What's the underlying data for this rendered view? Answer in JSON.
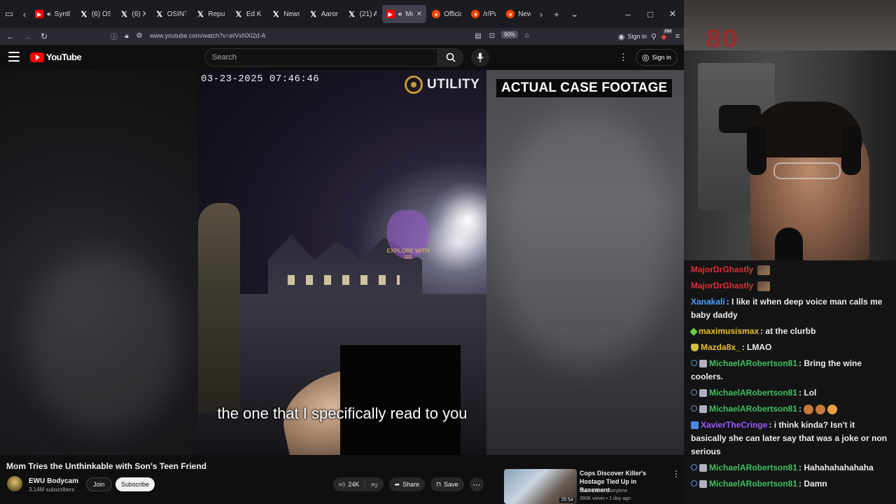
{
  "browser": {
    "tabs": [
      {
        "label": "Synth",
        "favicon": "yt",
        "audio": true
      },
      {
        "label": "(6) OS",
        "favicon": "x",
        "audio": false
      },
      {
        "label": "(6) X",
        "favicon": "x",
        "audio": false
      },
      {
        "label": "OSINT",
        "favicon": "x",
        "audio": false
      },
      {
        "label": "Repul",
        "favicon": "x",
        "audio": false
      },
      {
        "label": "Ed Kr",
        "favicon": "x",
        "audio": false
      },
      {
        "label": "News",
        "favicon": "x",
        "audio": false
      },
      {
        "label": "Aaron",
        "favicon": "x",
        "audio": false
      },
      {
        "label": "(21) A",
        "favicon": "x",
        "audio": false
      },
      {
        "label": "Mo",
        "favicon": "yt",
        "audio": true,
        "active": true
      },
      {
        "label": "Officia",
        "favicon": "rd",
        "audio": false
      },
      {
        "label": "/r/Pu",
        "favicon": "rd",
        "audio": false
      },
      {
        "label": "New",
        "favicon": "rd",
        "audio": false
      }
    ],
    "url": "www.youtube.com/watch?v=eIVsNXi2d-A",
    "zoom": "90%",
    "signin_label": "Sign in",
    "ext_badge": "264"
  },
  "youtube": {
    "logo_text": "YouTube",
    "search_placeholder": "Search",
    "signin_label": "Sign in"
  },
  "video": {
    "timestamp_overlay": "03-23-2025 07:46:46",
    "utility_label": "UTILITY",
    "banner": "ACTUAL CASE FOOTAGE",
    "watermark": "EXPLORE WITH US",
    "caption": "the one that I specifically read to you",
    "title": "Mom Tries the Unthinkable with Son's Teen Friend",
    "channel": "EWU Bodycam",
    "subscribers": "3.14M subscribers",
    "join_label": "Join",
    "subscribe_label": "Subscribe",
    "likes": "24K",
    "share_label": "Share",
    "save_label": "Save"
  },
  "recommended": {
    "title": "Cops Discover Killer's Hostage Tied Up in Basement",
    "channel": "EWU Crime Storytime",
    "meta": "390K views • 1 day ago",
    "duration": "25:54"
  },
  "stream": {
    "frame_badge": "80",
    "chat": [
      {
        "user": "MajorDrGhastly",
        "color": "#e0303a",
        "badges": [],
        "text": "",
        "avatar": true
      },
      {
        "user": "MajorDrGhastly",
        "color": "#e0303a",
        "badges": [],
        "text": "",
        "avatar": true
      },
      {
        "user": "Xanakali",
        "color": "#4aa0ff",
        "badges": [],
        "text": "I like it when deep voice man calls me baby daddy"
      },
      {
        "user": "maximusismax",
        "color": "#e8c030",
        "badges": [
          "diamond"
        ],
        "text": "at the clurbb"
      },
      {
        "user": "Mazda8x_",
        "color": "#e8c030",
        "badges": [
          "shield"
        ],
        "text": "LMAO"
      },
      {
        "user": "MichaelARobertson81",
        "color": "#40c060",
        "badges": [
          "person",
          "cam"
        ],
        "text": "Bring the wine coolers."
      },
      {
        "user": "MichaelARobertson81",
        "color": "#40c060",
        "badges": [
          "person",
          "cam"
        ],
        "text": "Lol"
      },
      {
        "user": "MichaelARobertson81",
        "color": "#40c060",
        "badges": [
          "person",
          "cam"
        ],
        "text": "",
        "emotes": 3
      },
      {
        "user": "XavierTheCringe",
        "color": "#9a5aff",
        "badges": [
          "prime"
        ],
        "text": "i think kinda? Isn't it basically she can later say that was a joke or non serious"
      },
      {
        "user": "MichaelARobertson81",
        "color": "#40c060",
        "badges": [
          "person",
          "cam"
        ],
        "text": "Hahahahahahaha"
      },
      {
        "user": "MichaelARobertson81",
        "color": "#40c060",
        "badges": [
          "person",
          "cam"
        ],
        "text": "Damn"
      }
    ]
  }
}
